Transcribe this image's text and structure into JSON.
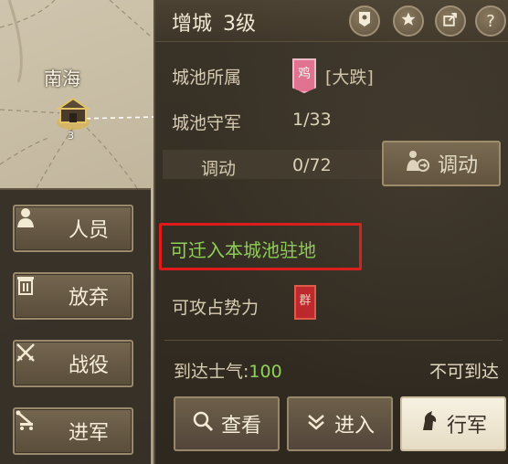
{
  "map": {
    "city_name": "南海",
    "city_level": "3",
    "side_buttons": [
      {
        "label": "人员",
        "icon": "person-icon"
      },
      {
        "label": "放弃",
        "icon": "trash-icon"
      },
      {
        "label": "战役",
        "icon": "crossed-swords-icon"
      },
      {
        "label": "进军",
        "icon": "catapult-icon"
      }
    ]
  },
  "panel": {
    "title": "增城",
    "level": "3级",
    "header_icons": [
      "flag-marker-icon",
      "star-icon",
      "share-icon",
      "help-icon"
    ],
    "help_glyph": "?",
    "owner_label": "城池所属",
    "owner_faction_char": "鸡",
    "owner_name": "[大跌]",
    "garrison_label": "城池守军",
    "garrison_value": "1/33",
    "transfer_label": "调动",
    "transfer_value": "0/72",
    "move_button_label": "调动",
    "relocate_text": "可迁入本城池驻地",
    "attack_label": "可攻占势力",
    "attack_faction_char": "群",
    "morale_label": "到达士气:",
    "morale_value": "100",
    "unreachable_text": "不可到达",
    "buttons": {
      "view": "查看",
      "enter": "进入",
      "march": "行军"
    }
  },
  "colors": {
    "highlight": "#e0191b",
    "positive_text": "#8fd15a",
    "owner_flag": "#e87494",
    "attack_flag": "#c0262a"
  }
}
